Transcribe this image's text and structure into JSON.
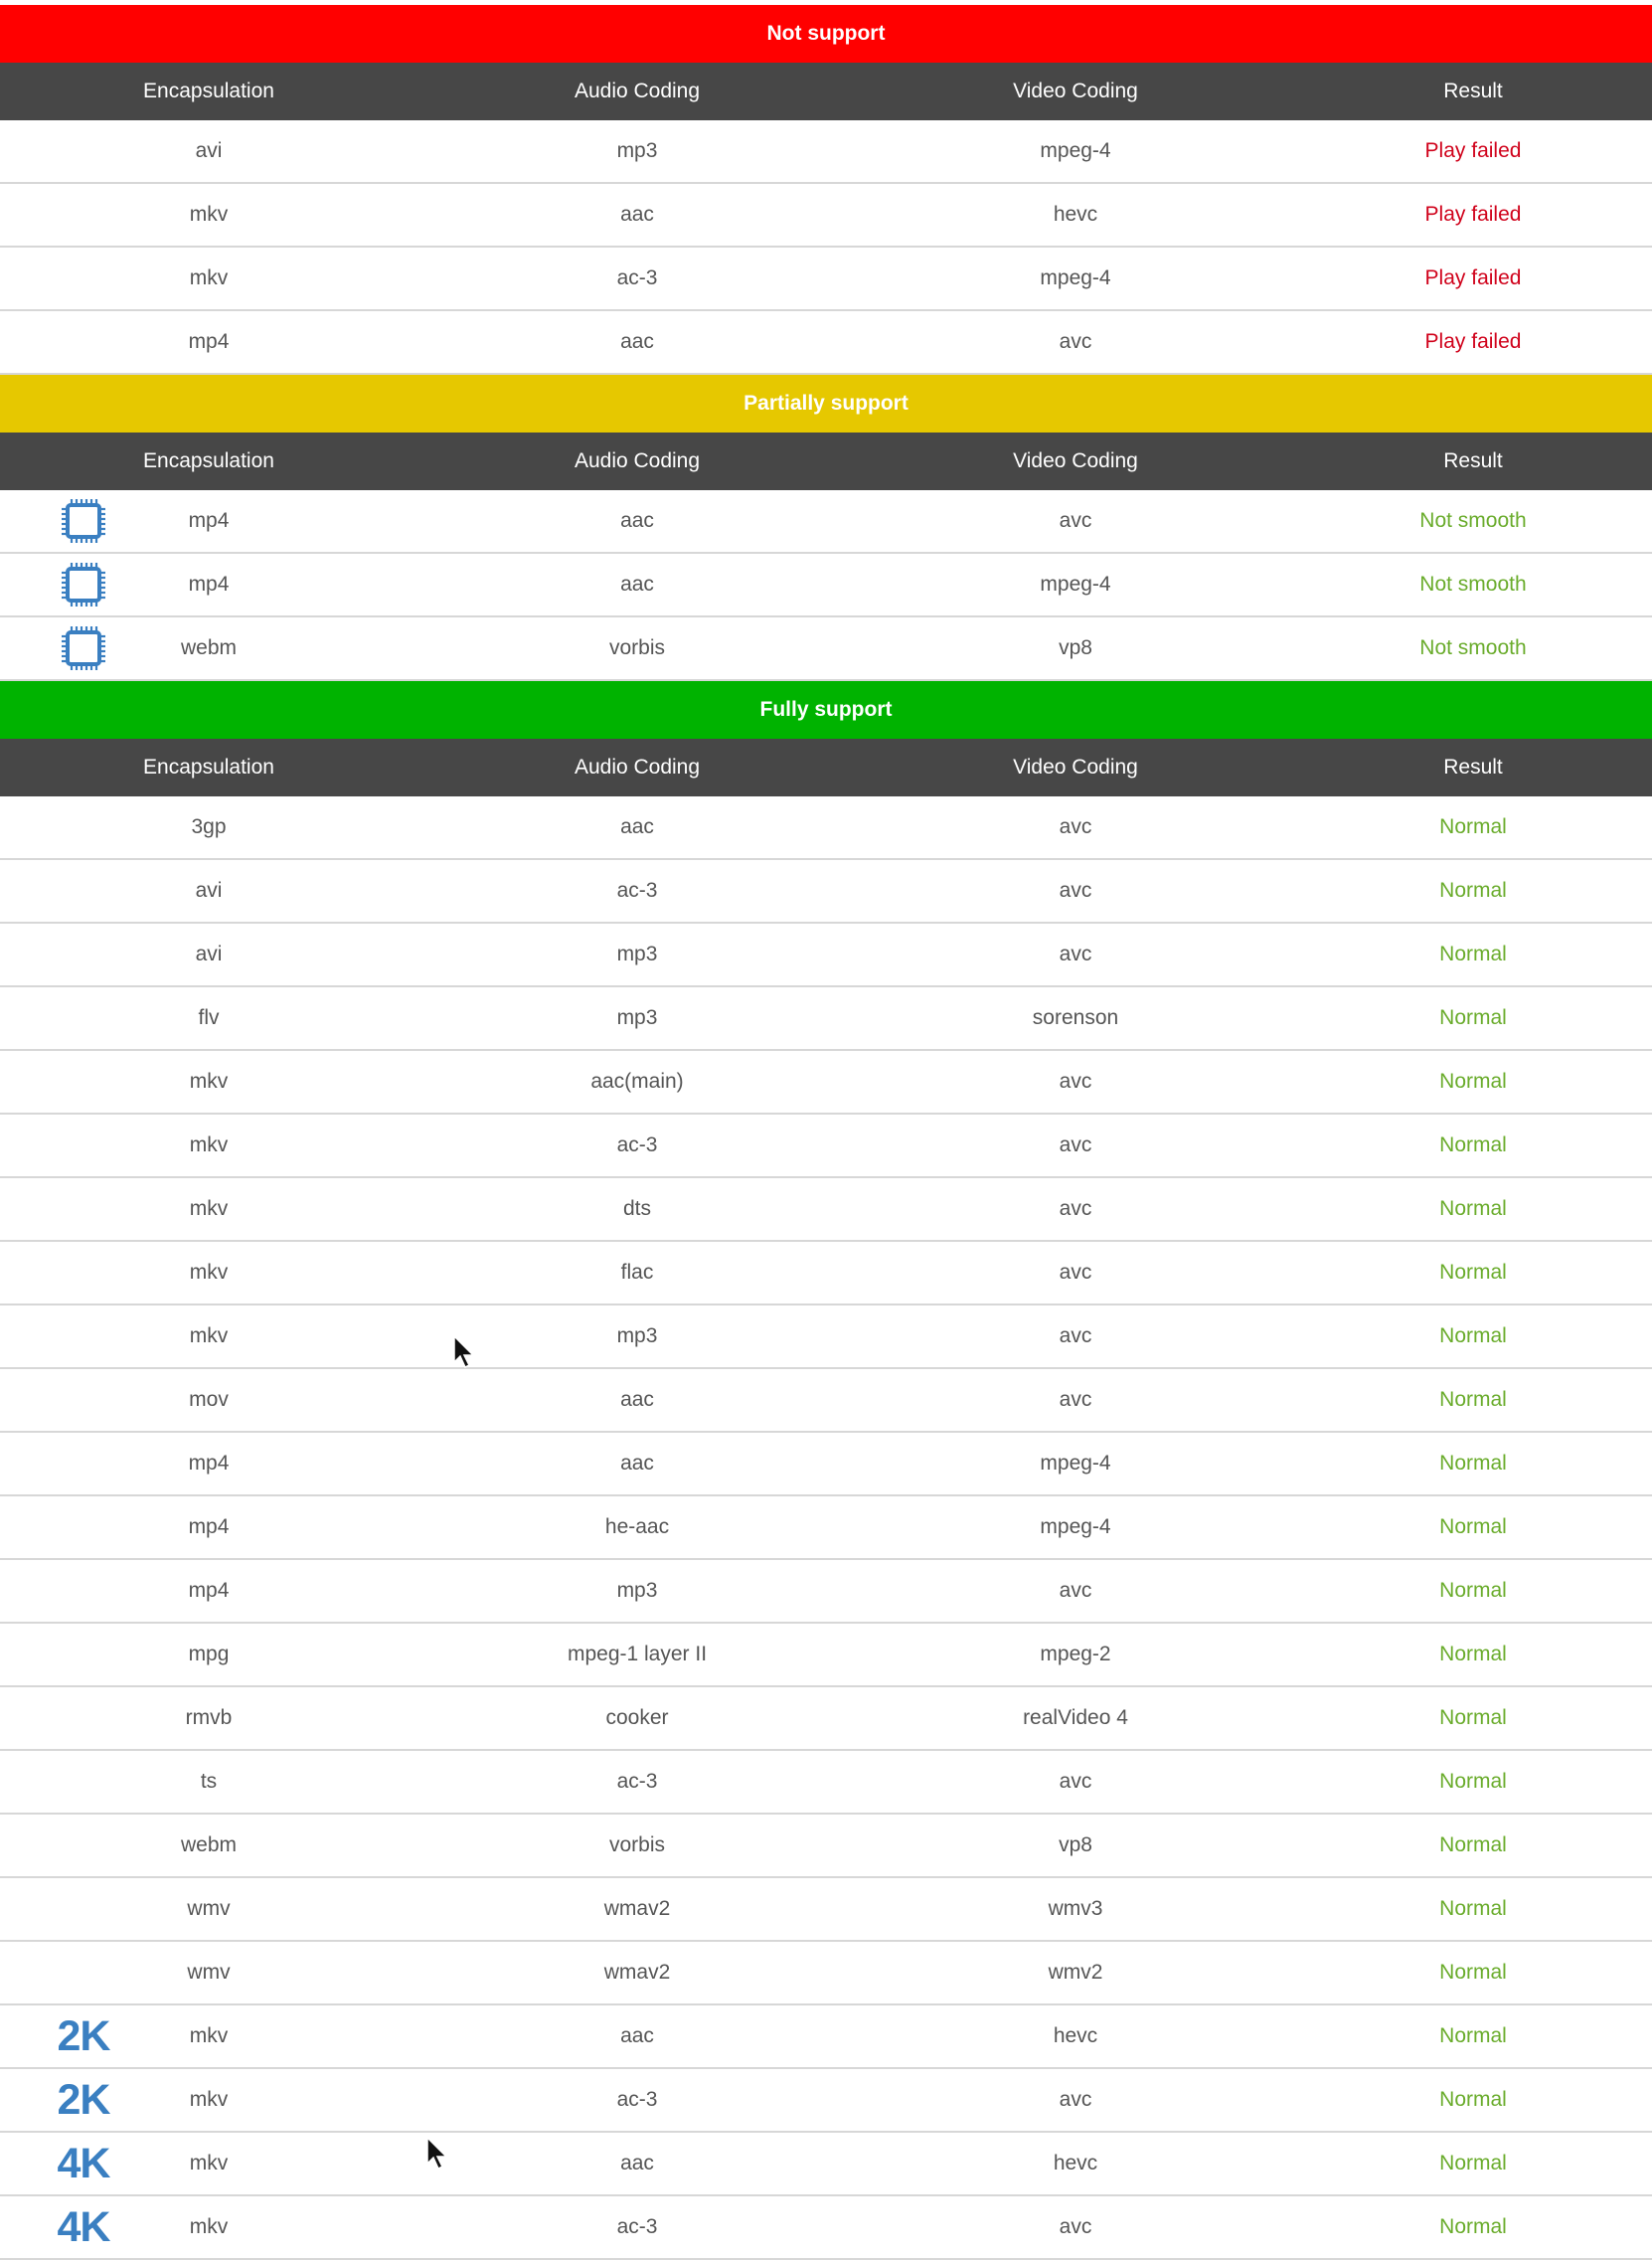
{
  "columns": [
    "Encapsulation",
    "Audio Coding",
    "Video Coding",
    "Result"
  ],
  "sections": [
    {
      "title": "Not support",
      "color": "#ff0000",
      "result_color": "#d0021b",
      "rows": [
        {
          "enc": "avi",
          "audio": "mp3",
          "video": "mpeg-4",
          "result": "Play failed"
        },
        {
          "enc": "mkv",
          "audio": "aac",
          "video": "hevc",
          "result": "Play failed"
        },
        {
          "enc": "mkv",
          "audio": "ac-3",
          "video": "mpeg-4",
          "result": "Play failed"
        },
        {
          "enc": "mp4",
          "audio": "aac",
          "video": "avc",
          "result": "Play failed"
        }
      ]
    },
    {
      "title": "Partially support",
      "color": "#e6c800",
      "result_color": "#6aac2c",
      "rows": [
        {
          "icon": "cpu-icon",
          "enc": "mp4",
          "audio": "aac",
          "video": "avc",
          "result": "Not smooth"
        },
        {
          "icon": "cpu-icon",
          "enc": "mp4",
          "audio": "aac",
          "video": "mpeg-4",
          "result": "Not smooth"
        },
        {
          "icon": "cpu-icon",
          "enc": "webm",
          "audio": "vorbis",
          "video": "vp8",
          "result": "Not smooth"
        }
      ]
    },
    {
      "title": "Fully support",
      "color": "#00b300",
      "result_color": "#6aac2c",
      "rows": [
        {
          "enc": "3gp",
          "audio": "aac",
          "video": "avc",
          "result": "Normal"
        },
        {
          "enc": "avi",
          "audio": "ac-3",
          "video": "avc",
          "result": "Normal"
        },
        {
          "enc": "avi",
          "audio": "mp3",
          "video": "avc",
          "result": "Normal"
        },
        {
          "enc": "flv",
          "audio": "mp3",
          "video": "sorenson",
          "result": "Normal"
        },
        {
          "enc": "mkv",
          "audio": "aac(main)",
          "video": "avc",
          "result": "Normal"
        },
        {
          "enc": "mkv",
          "audio": "ac-3",
          "video": "avc",
          "result": "Normal"
        },
        {
          "enc": "mkv",
          "audio": "dts",
          "video": "avc",
          "result": "Normal"
        },
        {
          "enc": "mkv",
          "audio": "flac",
          "video": "avc",
          "result": "Normal"
        },
        {
          "enc": "mkv",
          "audio": "mp3",
          "video": "avc",
          "result": "Normal"
        },
        {
          "enc": "mov",
          "audio": "aac",
          "video": "avc",
          "result": "Normal"
        },
        {
          "enc": "mp4",
          "audio": "aac",
          "video": "mpeg-4",
          "result": "Normal"
        },
        {
          "enc": "mp4",
          "audio": "he-aac",
          "video": "mpeg-4",
          "result": "Normal"
        },
        {
          "enc": "mp4",
          "audio": "mp3",
          "video": "avc",
          "result": "Normal"
        },
        {
          "enc": "mpg",
          "audio": "mpeg-1 layer II",
          "video": "mpeg-2",
          "result": "Normal"
        },
        {
          "enc": "rmvb",
          "audio": "cooker",
          "video": "realVideo 4",
          "result": "Normal"
        },
        {
          "enc": "ts",
          "audio": "ac-3",
          "video": "avc",
          "result": "Normal"
        },
        {
          "enc": "webm",
          "audio": "vorbis",
          "video": "vp8",
          "result": "Normal"
        },
        {
          "enc": "wmv",
          "audio": "wmav2",
          "video": "wmv3",
          "result": "Normal"
        },
        {
          "enc": "wmv",
          "audio": "wmav2",
          "video": "wmv2",
          "result": "Normal"
        },
        {
          "badge": "2K",
          "enc": "mkv",
          "audio": "aac",
          "video": "hevc",
          "result": "Normal"
        },
        {
          "badge": "2K",
          "enc": "mkv",
          "audio": "ac-3",
          "video": "avc",
          "result": "Normal"
        },
        {
          "badge": "4K",
          "enc": "mkv",
          "audio": "aac",
          "video": "hevc",
          "result": "Normal"
        },
        {
          "badge": "4K",
          "enc": "mkv",
          "audio": "ac-3",
          "video": "avc",
          "result": "Normal"
        }
      ]
    }
  ],
  "cursors": [
    "mouse-cursor-icon",
    "mouse-cursor-icon"
  ]
}
